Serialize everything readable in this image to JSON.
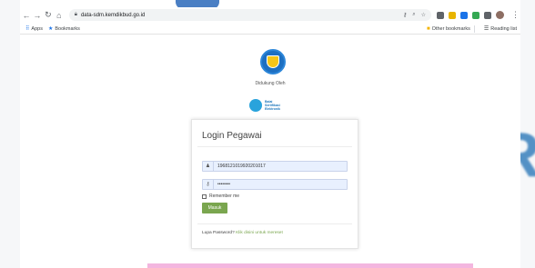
{
  "browser": {
    "url": "data-sdm.kemdikbud.go.id",
    "bookmarks": {
      "apps_label": "Apps",
      "bookmarks_label": "Bookmarks",
      "other_label": "Other bookmarks",
      "reading_list_label": "Reading list"
    }
  },
  "page": {
    "supported_by": "Didukung Oleh",
    "sponsor_text": [
      "Balai",
      "Sertifikasi",
      "Elektronik"
    ]
  },
  "login": {
    "title": "Login Pegawai",
    "username_value": "1968121019920201017",
    "password_value": "••••••••",
    "remember_label": "Remember me",
    "submit_label": "Masuk",
    "forgot_prefix": "Lupa Password?",
    "forgot_link": "Klik disini untuk mereset"
  },
  "backdrop": {
    "letter": "R"
  },
  "colors": {
    "accent_green": "#7aa64f",
    "field_bg": "#e8f0fe",
    "logo_blue": "#1d6fc1",
    "pink_bar": "#f3b6df"
  }
}
